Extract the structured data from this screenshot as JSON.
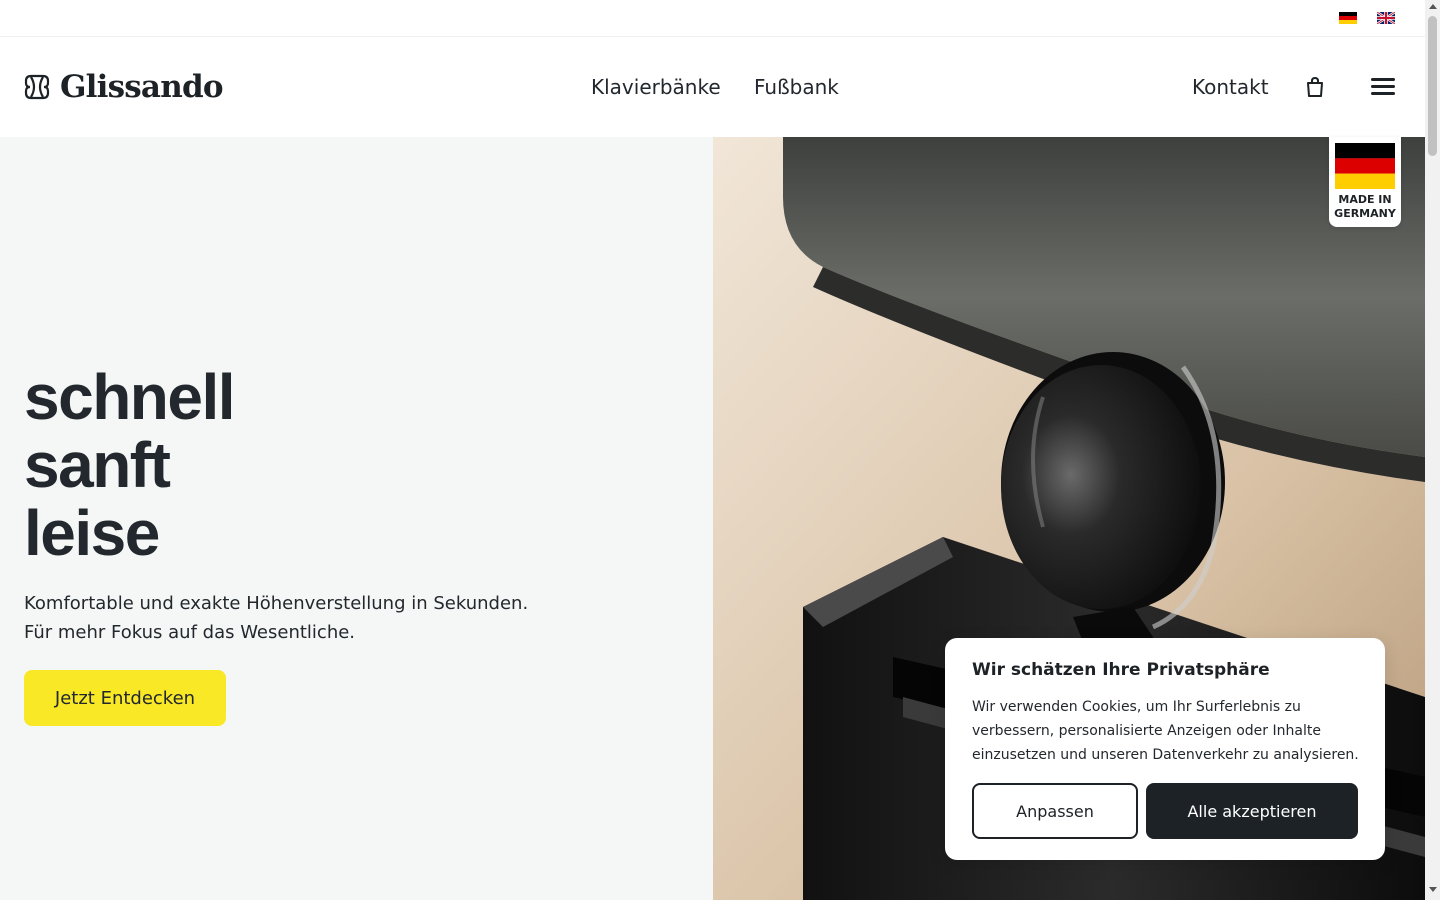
{
  "languages": [
    {
      "code": "de",
      "icon": "german-flag-icon"
    },
    {
      "code": "en",
      "icon": "uk-flag-icon"
    }
  ],
  "header": {
    "brand": "Glissando",
    "nav": [
      "Klavierbänke",
      "Fußbank"
    ],
    "contact": "Kontakt",
    "cart_icon": "shopping-bag-icon",
    "menu_icon": "hamburger-menu-icon"
  },
  "hero": {
    "headline": [
      "schnell",
      "sanft",
      "leise"
    ],
    "subline": [
      "Komfortable und exakte Höhenverstellung in Sekunden.",
      "Für mehr Fokus auf das Wesentliche."
    ],
    "cta": "Jetzt Entdecken",
    "cta_color": "#f8e826"
  },
  "badge": {
    "line1": "MADE IN",
    "line2": "GERMANY"
  },
  "cookie": {
    "title": "Wir schätzen Ihre Privatsphäre",
    "text": "Wir verwenden Cookies, um Ihr Surferlebnis zu verbessern, personalisierte Anzeigen oder Inhalte einzusetzen und unseren Datenverkehr zu analysieren.",
    "customize": "Anpassen",
    "accept": "Alle akzeptieren"
  },
  "colors": {
    "text": "#22282d",
    "dark": "#1d2226",
    "hero_bg": "#f5f7f6"
  }
}
